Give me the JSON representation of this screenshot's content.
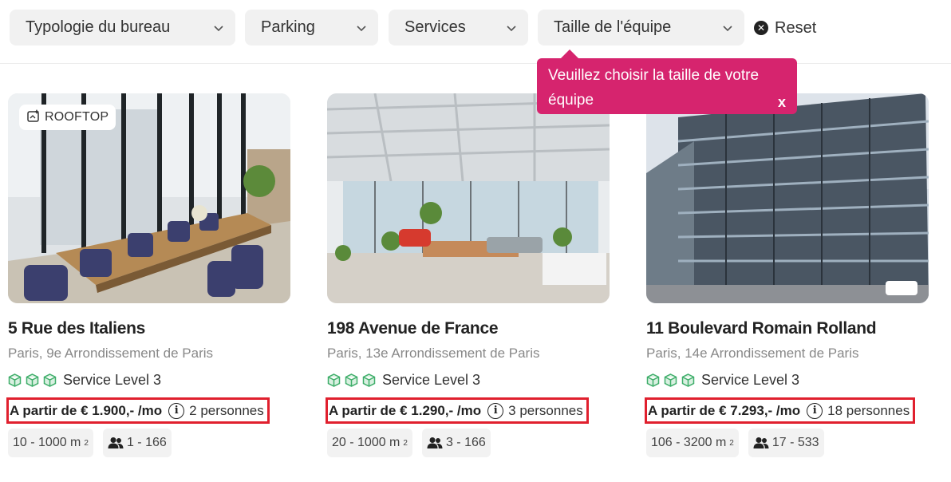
{
  "filters": [
    {
      "label": "Typologie du bureau",
      "icon": "chevron-down-icon"
    },
    {
      "label": "Parking",
      "icon": "chevron-down-icon"
    },
    {
      "label": "Services",
      "icon": "chevron-down-icon"
    },
    {
      "label": "Taille de l'équipe",
      "icon": "chevron-down-icon"
    }
  ],
  "reset_label": "Reset",
  "tooltip": {
    "line1": "Veuillez choisir la taille de votre",
    "line2": "équipe",
    "close": "x"
  },
  "listings": [
    {
      "badge": "ROOFTOP",
      "title": "5 Rue des Italiens",
      "city": "Paris",
      "district": "9e Arrondissement de Paris",
      "service": "Service Level 3",
      "price": "A partir de € 1.900,- /mo",
      "persons": "2 personnes",
      "area": "10 - 1000 m",
      "area_unit_sup": "2",
      "capacity": "1 - 166"
    },
    {
      "badge": "",
      "title": "198 Avenue de France",
      "city": "Paris",
      "district": "13e Arrondissement de Paris",
      "service": "Service Level 3",
      "price": "A partir de € 1.290,- /mo",
      "persons": "3 personnes",
      "area": "20 - 1000 m",
      "area_unit_sup": "2",
      "capacity": "3 - 166"
    },
    {
      "badge": "",
      "title": "11 Boulevard Romain Rolland",
      "city": "Paris",
      "district": "14e Arrondissement de Paris",
      "service": "Service Level 3",
      "price": "A partir de € 7.293,- /mo",
      "persons": "18 personnes",
      "area": "106 - 3200 m",
      "area_unit_sup": "2",
      "capacity": "17 - 533"
    }
  ],
  "colors": {
    "accent_pink": "#d6246e",
    "highlight_red": "#e0202e",
    "service_green": "#3fae6a",
    "chip_bg": "#f2f2f2"
  }
}
